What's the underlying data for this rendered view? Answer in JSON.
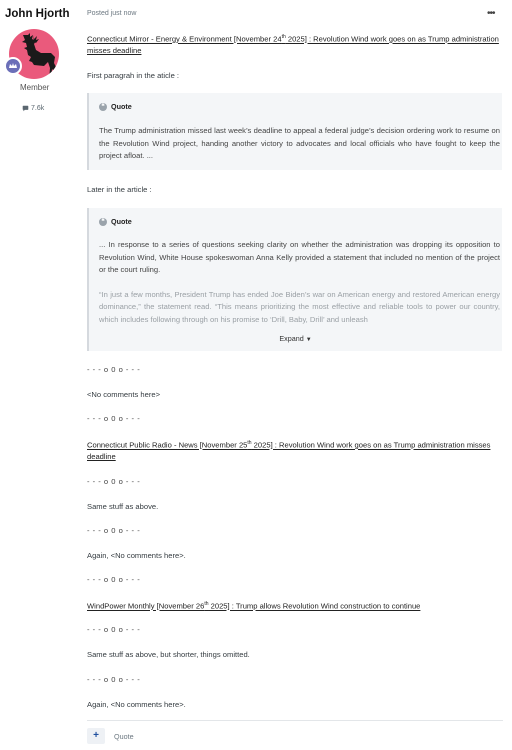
{
  "author": {
    "name": "John Hjorth",
    "title": "Member",
    "post_count": "7.6k"
  },
  "post": {
    "meta": "Posted just now",
    "more_label": "•••",
    "link1": {
      "prefix": "Connecticut Mirror - Energy & Environment [November 24",
      "sup": "th",
      "suffix": " 2025] : Revolution Wind work goes on as Trump administration misses deadline"
    },
    "intro1": "First paragrah in the aticle :",
    "quote1": {
      "label": "Quote",
      "text": "The Trump administration missed last week’s deadline to appeal a federal judge’s decision ordering work to resume on the Revolution Wind project, handing another victory to advocates and local officials who have fought to keep the project afloat. ..."
    },
    "intro2": "Later in the article :",
    "quote2": {
      "label": "Quote",
      "text1": "... In response to a series of questions seeking clarity on whether the administration was dropping its opposition to Revolution Wind, White House spokeswoman Anna Kelly provided a statement that included no mention of the project or the court ruling.",
      "text2": "“In just a few months, President Trump has ended Joe Biden’s war on American energy and restored American energy dominance,” the statement read. “This means prioritizing the most effective and reliable tools to power our country, which includes following through on his promise to ‘Drill, Baby, Drill’ and unleash",
      "expand": "Expand"
    },
    "sep": "- - - o 0 o - - -",
    "no_comments": "<No comments here>",
    "link2": {
      "prefix": "Connecticut Public Radio - News [November 25",
      "sup": "th",
      "suffix": " 2025] : Revolution Wind work goes on as Trump administration misses deadline"
    },
    "same_stuff": "Same stuff as above.",
    "again_no_comments": "Again, <No comments here>.",
    "link3": {
      "prefix": "WindPower Monthly [November 26",
      "sup": "th",
      "suffix": " 2025] : Trump allows Revolution Wind construction to continue"
    },
    "same_stuff_shorter": "Same stuff as above, but shorter, things omitted.",
    "again_no_comments2": "Again, <No comments here>."
  },
  "footer": {
    "plus_label": "+",
    "quote_label": "Quote"
  }
}
